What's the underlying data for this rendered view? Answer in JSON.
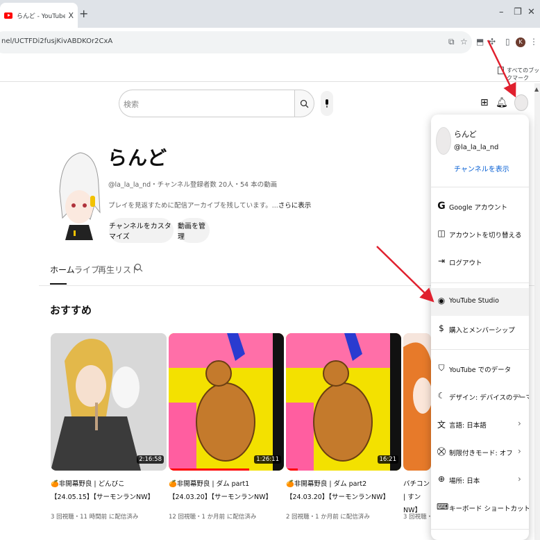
{
  "browser": {
    "tab_title": "らんど - YouTube",
    "tab_close": "X",
    "new_tab": "+",
    "url": "nel/UCTFDi2fusjKivABDKOr2CxA",
    "bookmarks_label": "すべてのブックマーク",
    "profile_initial": "K"
  },
  "youtube": {
    "search_placeholder": "検索"
  },
  "channel": {
    "name": "らんど",
    "meta": "@la_la_la_nd・チャンネル登録者数 20人・54 本の動画",
    "description": "プレイを見返すために配信アーカイブを残しています。...",
    "more": "さらに表示",
    "customize_button": "チャンネルをカスタマイズ",
    "manage_button": "動画を管理",
    "tabs": [
      "ホーム",
      "ライブ",
      "再生リスト"
    ],
    "section_title": "おすすめ"
  },
  "videos": [
    {
      "title": "🍊非開幕野良 | どんびこ【24.05.15】【サーモンランNW】",
      "meta": "3 回視聴・11 時間前 に配信済み",
      "duration": "2:16:58",
      "progress": 0
    },
    {
      "title": "🍊非開幕野良 | ダム part1【24.03.20】【サーモンランNW】",
      "meta": "12 回視聴・1 か月前 に配信済み",
      "duration": "1:26:11",
      "progress": 0.7
    },
    {
      "title": "🍊非開幕野良 | ダム part2【24.03.20】【サーモンランNW】",
      "meta": "2 回視聴・1 か月前 に配信済み",
      "duration": "16:21",
      "progress": 0.1
    },
    {
      "title": "バチコン | すンNW】",
      "meta": "3 回視聴・",
      "duration": "",
      "progress": 0
    }
  ],
  "menu": {
    "name": "らんど",
    "handle": "@la_la_la_nd",
    "view_channel": "チャンネルを表示",
    "items": [
      {
        "label": "Google アカウント",
        "icon": "google-icon",
        "chevron": false
      },
      {
        "label": "アカウントを切り替える",
        "icon": "switch-account-icon",
        "chevron": true
      },
      {
        "label": "ログアウト",
        "icon": "logout-icon",
        "chevron": false
      },
      {
        "label": "YouTube Studio",
        "icon": "studio-icon",
        "chevron": false
      },
      {
        "label": "購入とメンバーシップ",
        "icon": "dollar-icon",
        "chevron": false
      },
      {
        "label": "YouTube でのデータ",
        "icon": "shield-icon",
        "chevron": false
      },
      {
        "label": "デザイン: デバイスのテーマ",
        "icon": "moon-icon",
        "chevron": true
      },
      {
        "label": "言語: 日本語",
        "icon": "translate-icon",
        "chevron": true
      },
      {
        "label": "制限付きモード: オフ",
        "icon": "restricted-icon",
        "chevron": true
      },
      {
        "label": "場所: 日本",
        "icon": "globe-icon",
        "chevron": true
      },
      {
        "label": "キーボード ショートカット",
        "icon": "keyboard-icon",
        "chevron": false
      }
    ]
  },
  "colors": {
    "accent": "#ff0000",
    "link": "#065fd4",
    "annotation_arrow": "#e0202e"
  }
}
